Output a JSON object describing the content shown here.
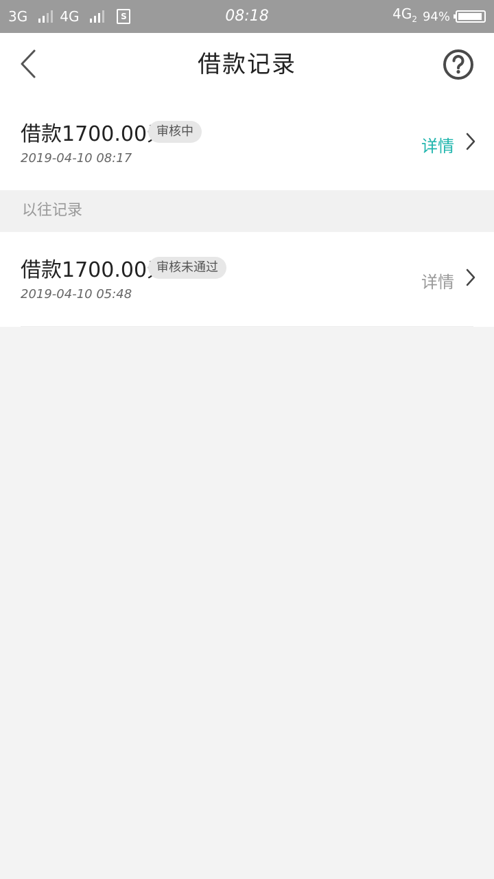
{
  "status_bar": {
    "network_1": "3G",
    "network_2": "4G",
    "time": "08:18",
    "data_network": "4G",
    "data_network_sub": "2",
    "battery_percent": "94%",
    "battery_level": 0.94
  },
  "header": {
    "title": "借款记录",
    "back_icon": "chevron-left-icon",
    "help_icon": "question-circle-icon"
  },
  "current_record": {
    "amount": "借款1700.00元",
    "status": "审核中",
    "time": "2019-04-10 08:17",
    "detail_label": "详情",
    "detail_color": "#1fb5ad"
  },
  "past_section": {
    "title": "以往记录"
  },
  "past_records": [
    {
      "amount": "借款1700.00元",
      "status": "审核未通过",
      "time": "2019-04-10 05:48",
      "detail_label": "详情",
      "detail_color": "#999999"
    }
  ]
}
